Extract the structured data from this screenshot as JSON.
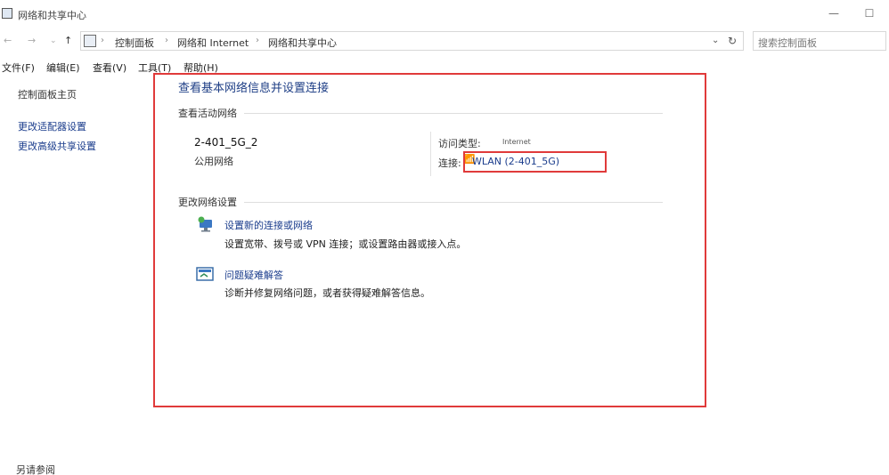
{
  "window": {
    "title": "网络和共享中心"
  },
  "titlebar": {
    "minimize": "—",
    "maximize": "☐",
    "close": "✕"
  },
  "address": {
    "nav_back": "←",
    "nav_forward": "→",
    "nav_recent": "⌄",
    "nav_up": "↑",
    "breadcrumbs": [
      "控制面板",
      "网络和 Internet",
      "网络和共享中心"
    ],
    "separator": "›",
    "dropdown": "⌄",
    "refresh": "↻",
    "search_placeholder": "搜索控制面板"
  },
  "menu": [
    "文件(F)",
    "编辑(E)",
    "查看(V)",
    "工具(T)",
    "帮助(H)"
  ],
  "left": {
    "title": "控制面板主页",
    "links": [
      "更改适配器设置",
      "更改高级共享设置"
    ],
    "footer": "另请参阅"
  },
  "main": {
    "title": "查看基本网络信息并设置连接",
    "active_section": "查看活动网络",
    "network": {
      "name": "2-401_5G_2",
      "category": "公用网络",
      "access_label": "访问类型:",
      "access_value": "Internet",
      "conn_label": "连接:",
      "conn_glyph": "📶",
      "conn_value": "WLAN (2-401_5G)"
    },
    "change_section": "更改网络设置",
    "tasks": [
      {
        "link": "设置新的连接或网络",
        "desc": "设置宽带、拨号或 VPN 连接；或设置路由器或接入点。"
      },
      {
        "link": "问题疑难解答",
        "desc": "诊断并修复网络问题，或者获得疑难解答信息。"
      }
    ]
  },
  "colors": {
    "link": "#1a3c8c",
    "title": "#1f3f86",
    "annotation": "#e03a3a"
  },
  "icons": [
    "network-icon",
    "new-connection-icon",
    "troubleshoot-icon",
    "wifi-signal-icon"
  ]
}
